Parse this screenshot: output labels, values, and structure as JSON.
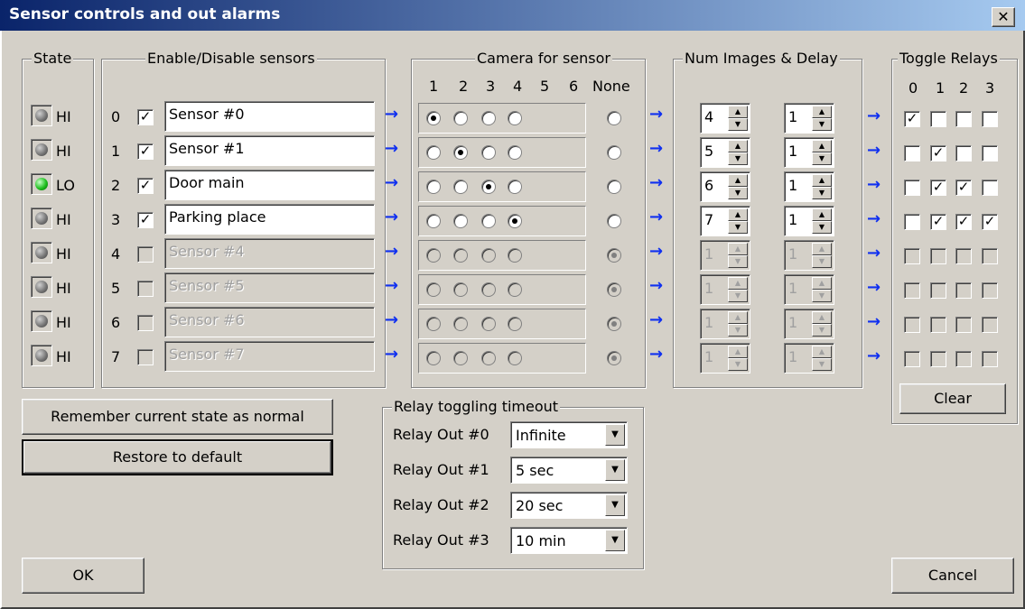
{
  "window": {
    "title": "Sensor controls and out alarms",
    "close_label": "✕"
  },
  "groups": {
    "state": "State",
    "enable": "Enable/Disable sensors",
    "camera": "Camera for sensor",
    "num_images": "Num Images & Delay",
    "toggle_relays": "Toggle Relays",
    "relay_timeout": "Relay toggling timeout"
  },
  "camera_columns": [
    "1",
    "2",
    "3",
    "4",
    "5",
    "6",
    "None"
  ],
  "relay_columns": [
    "0",
    "1",
    "2",
    "3"
  ],
  "sensors": [
    {
      "idx": "0",
      "state": "HI",
      "led": "off",
      "enabled": true,
      "name": "Sensor #0",
      "camera": 0,
      "images": "4",
      "delay": "1",
      "relays": [
        true,
        false,
        false,
        false
      ]
    },
    {
      "idx": "1",
      "state": "HI",
      "led": "off",
      "enabled": true,
      "name": "Sensor #1",
      "camera": 1,
      "images": "5",
      "delay": "1",
      "relays": [
        false,
        true,
        false,
        false
      ]
    },
    {
      "idx": "2",
      "state": "LO",
      "led": "on",
      "enabled": true,
      "name": "Door main",
      "camera": 2,
      "images": "6",
      "delay": "1",
      "relays": [
        false,
        true,
        true,
        false
      ]
    },
    {
      "idx": "3",
      "state": "HI",
      "led": "off",
      "enabled": true,
      "name": "Parking place",
      "camera": 3,
      "images": "7",
      "delay": "1",
      "relays": [
        false,
        true,
        true,
        true
      ]
    },
    {
      "idx": "4",
      "state": "HI",
      "led": "off",
      "enabled": false,
      "name": "Sensor #4",
      "camera": "none",
      "images": "1",
      "delay": "1",
      "relays": [
        false,
        false,
        false,
        false
      ]
    },
    {
      "idx": "5",
      "state": "HI",
      "led": "off",
      "enabled": false,
      "name": "Sensor #5",
      "camera": "none",
      "images": "1",
      "delay": "1",
      "relays": [
        false,
        false,
        false,
        false
      ]
    },
    {
      "idx": "6",
      "state": "HI",
      "led": "off",
      "enabled": false,
      "name": "Sensor #6",
      "camera": "none",
      "images": "1",
      "delay": "1",
      "relays": [
        false,
        false,
        false,
        false
      ]
    },
    {
      "idx": "7",
      "state": "HI",
      "led": "off",
      "enabled": false,
      "name": "Sensor #7",
      "camera": "none",
      "images": "1",
      "delay": "1",
      "relays": [
        false,
        false,
        false,
        false
      ]
    }
  ],
  "buttons": {
    "remember": "Remember current state as normal",
    "restore": "Restore to default",
    "clear": "Clear",
    "ok": "OK",
    "cancel": "Cancel"
  },
  "relay_timeouts": [
    {
      "label": "Relay Out #0",
      "value": "Infinite"
    },
    {
      "label": "Relay Out #1",
      "value": "5 sec"
    },
    {
      "label": "Relay Out #2",
      "value": "20 sec"
    },
    {
      "label": "Relay Out #3",
      "value": "10 min"
    }
  ],
  "arrow_glyph": "→",
  "colors": {
    "title_start": "#0a246a",
    "title_end": "#a6caf0",
    "face": "#d4d0c8",
    "arrow": "#1030f0",
    "led_on": "#20c020"
  }
}
